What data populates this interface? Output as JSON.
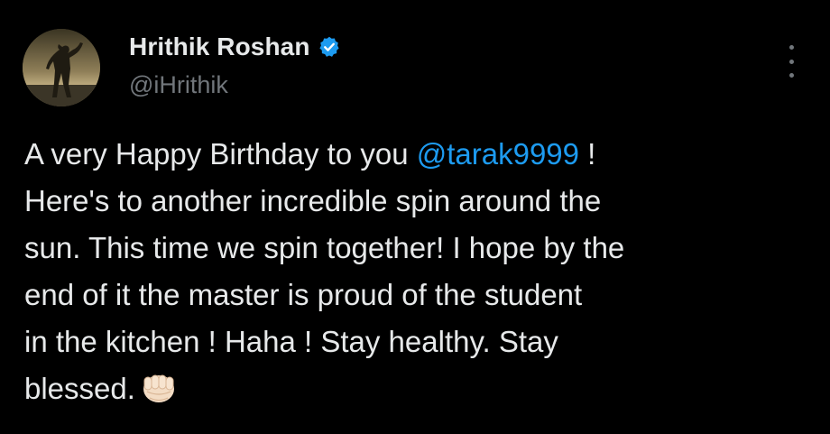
{
  "author": {
    "display_name": "Hrithik Roshan",
    "handle": "@iHrithik",
    "verified": true,
    "verified_color": "#1d9bf0"
  },
  "tweet": {
    "line1_before": "A very Happy Birthday to you ",
    "mention": "@tarak9999",
    "line1_after": " !",
    "line2": "Here's to another incredible spin around the",
    "line3": "sun. This time we spin together! I hope by the",
    "line4": "end of it the master is proud of the student",
    "line5": "in the kitchen ! Haha ! Stay healthy. Stay",
    "line6": "blessed.",
    "emoji": "oncoming-fist-icon"
  },
  "colors": {
    "background": "#000000",
    "text": "#e7e9ea",
    "muted": "#71767b",
    "link": "#1d9bf0"
  },
  "icons": {
    "more": "more-vertical-icon",
    "verified": "verified-badge-icon"
  }
}
